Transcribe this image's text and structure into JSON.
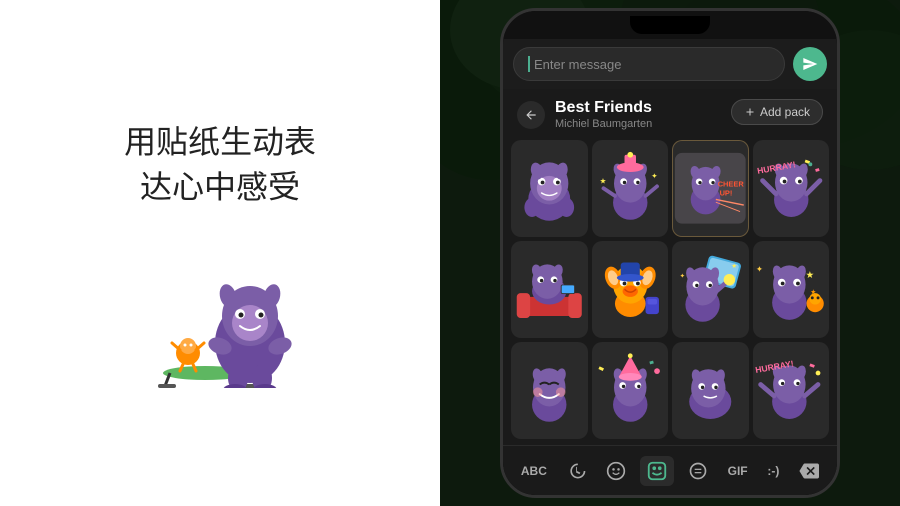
{
  "left": {
    "title_line1": "用贴纸生动表",
    "title_line2": "达心中感受"
  },
  "phone": {
    "message_placeholder": "Enter message",
    "pack": {
      "title": "Best Friends",
      "author": "Michiel Baumgarten",
      "add_button": "+ Add pack"
    },
    "toolbar": {
      "abc": "ABC",
      "gif": "GIF",
      "smiley": ":-)"
    }
  }
}
